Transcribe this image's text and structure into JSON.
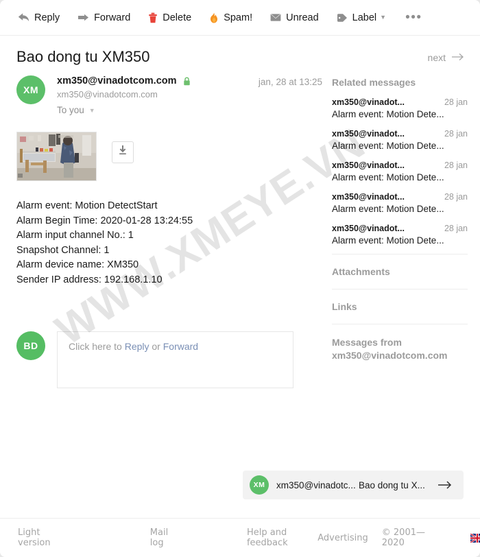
{
  "toolbar": {
    "items": [
      {
        "label": "Reply",
        "icon": "reply-arrow-icon"
      },
      {
        "label": "Forward",
        "icon": "forward-arrow-icon"
      },
      {
        "label": "Delete",
        "icon": "trash-icon"
      },
      {
        "label": "Spam!",
        "icon": "flame-icon"
      },
      {
        "label": "Unread",
        "icon": "envelope-icon"
      },
      {
        "label": "Label",
        "icon": "tag-icon"
      }
    ],
    "more": "•••"
  },
  "header": {
    "subject": "Bao dong tu XM350",
    "next_label": "next"
  },
  "message": {
    "avatar_initials": "XM",
    "sender_name": "xm350@vinadotcom.com",
    "sender_email": "xm350@vinadotcom.com",
    "recipients": "To you",
    "date": "jan, 28 at 13:25",
    "body_lines": [
      "Alarm event: Motion DetectStart",
      "Alarm Begin Time: 2020-01-28 13:24:55",
      "Alarm input channel No.: 1",
      "Snapshot Channel: 1",
      "Alarm device name: XM350",
      "Sender IP address: 192.168.1.10"
    ]
  },
  "reply": {
    "avatar_initials": "BD",
    "placeholder_prefix": "Click here to ",
    "reply_link": "Reply",
    "or_text": " or ",
    "forward_link": "Forward"
  },
  "sidebar": {
    "related_title": "Related messages",
    "related": [
      {
        "from": "xm350@vinadot...",
        "date": "28 jan",
        "subject": "Alarm event: Motion Dete..."
      },
      {
        "from": "xm350@vinadot...",
        "date": "28 jan",
        "subject": "Alarm event: Motion Dete..."
      },
      {
        "from": "xm350@vinadot...",
        "date": "28 jan",
        "subject": "Alarm event: Motion Dete..."
      },
      {
        "from": "xm350@vinadot...",
        "date": "28 jan",
        "subject": "Alarm event: Motion Dete..."
      },
      {
        "from": "xm350@vinadot...",
        "date": "28 jan",
        "subject": "Alarm event: Motion Dete..."
      }
    ],
    "attachments_label": "Attachments",
    "links_label": "Links",
    "messages_from_label": "Messages from",
    "messages_from_address": "xm350@vinadotcom.com"
  },
  "next_message": {
    "avatar_initials": "XM",
    "from": "xm350@vinadotc...",
    "subject": "Bao dong tu X..."
  },
  "footer": {
    "links": [
      "Light version",
      "Mail log",
      "Help and feedback",
      "Advertising"
    ],
    "copyright": "© 2001—2020",
    "flag": "uk-flag-icon"
  },
  "watermark": {
    "text": "WWW.XMEYE.VN"
  },
  "colors": {
    "avatar_green": "#5cbf69",
    "delete_red": "#e8443a",
    "spam_orange": "#f59322",
    "lock_green": "#6ec06e",
    "link_blue": "#7a8fb5"
  }
}
